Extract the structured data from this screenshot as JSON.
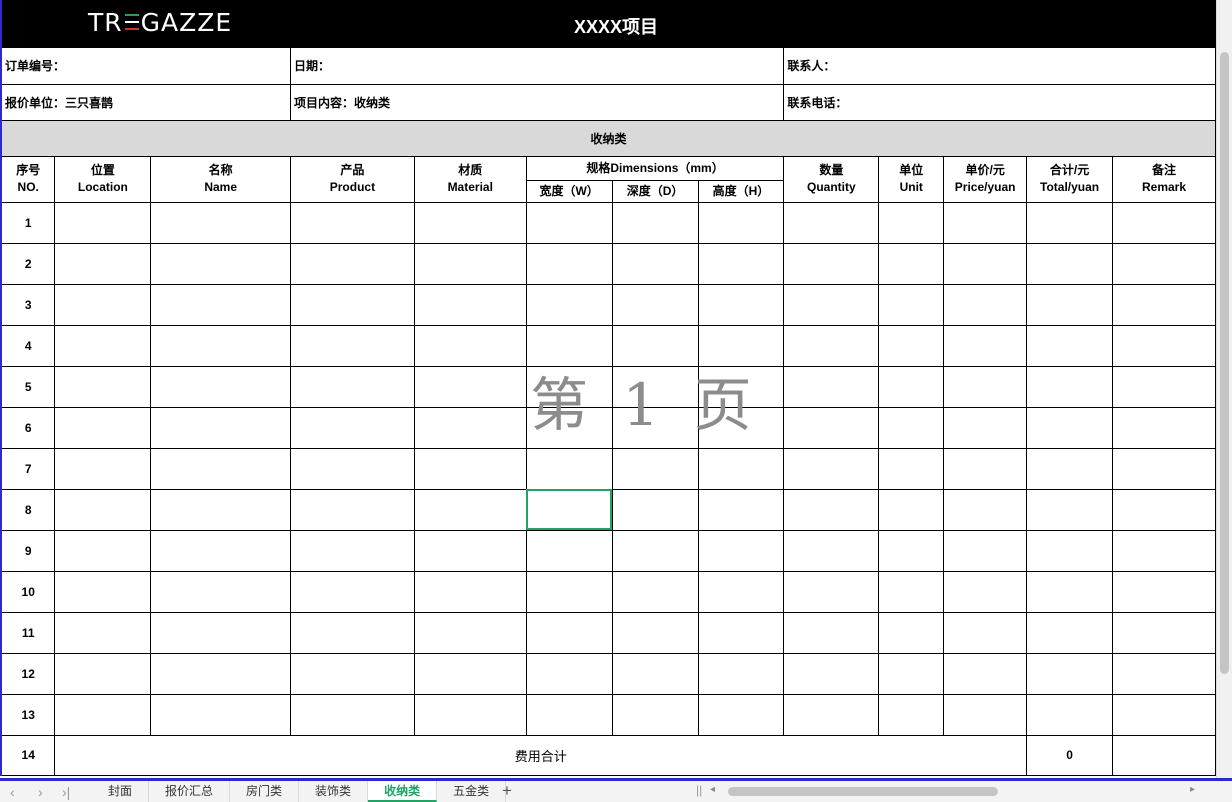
{
  "header": {
    "logo": {
      "before": "TR",
      "after": "GAZZE"
    },
    "title": "XXXX项目"
  },
  "info": {
    "order_no_label": "订单编号：",
    "date_label": "日期：",
    "contact_label": "联系人：",
    "quote_unit_label": "报价单位：三只喜鹊",
    "project_content_label": "项目内容：收纳类",
    "phone_label": "联系电话："
  },
  "section_title": "收纳类",
  "columns": {
    "no": {
      "cn": "序号",
      "en": "NO."
    },
    "location": {
      "cn": "位置",
      "en": "Location"
    },
    "name": {
      "cn": "名称",
      "en": "Name"
    },
    "product": {
      "cn": "产品",
      "en": "Product"
    },
    "material": {
      "cn": "材质",
      "en": "Material"
    },
    "dimensions": "规格Dimensions（mm）",
    "width": "宽度（W）",
    "depth": "深度（D）",
    "height": "高度（H）",
    "quantity": {
      "cn": "数量",
      "en": "Quantity"
    },
    "unit": {
      "cn": "单位",
      "en": "Unit"
    },
    "price": {
      "cn": "单价/元",
      "en": "Price/yuan"
    },
    "total": {
      "cn": "合计/元",
      "en": "Total/yuan"
    },
    "remark": {
      "cn": "备注",
      "en": "Remark"
    }
  },
  "rows": [
    "1",
    "2",
    "3",
    "4",
    "5",
    "6",
    "7",
    "8",
    "9",
    "10",
    "11",
    "12",
    "13"
  ],
  "total_row": {
    "no": "14",
    "label": "费用合计",
    "value": "0"
  },
  "watermark": "第 1 页",
  "sheet_tabs": [
    "封面",
    "报价汇总",
    "房门类",
    "装饰类",
    "收纳类",
    "五金类"
  ],
  "active_tab": "收纳类",
  "colors": {
    "accent": "#21a366",
    "header_bg": "#000000",
    "section_bg": "#d9d9d9",
    "flag_green": "#2e9e44",
    "flag_red": "#d0312d"
  }
}
